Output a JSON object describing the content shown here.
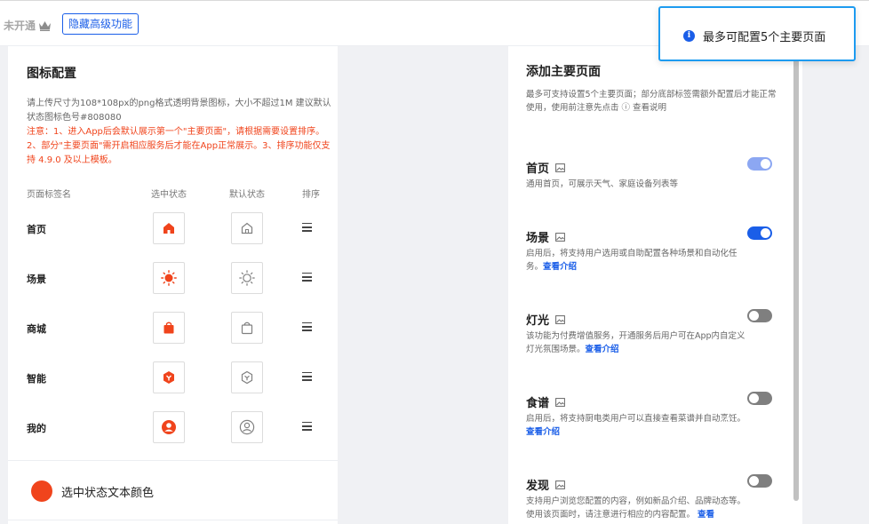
{
  "topbar": {
    "plan_label": "未开通",
    "hide_button": "隐藏高级功能"
  },
  "icon_config": {
    "title": "图标配置",
    "description": "请上传尺寸为108*108px的png格式透明背景图标，大小不超过1M 建议默认状态图标色号#808080",
    "notice": "注意：1、进入App后会默认展示第一个\"主要页面\"，请根据需要设置排序。2、部分\"主要页面\"需开启相应服务后才能在App正常展示。3、排序功能仅支持 4.9.0 及以上模板。",
    "columns": [
      "页面标签名",
      "选中状态",
      "默认状态",
      "排序"
    ],
    "rows": [
      {
        "label": "首页",
        "icon": "home-icon"
      },
      {
        "label": "场景",
        "icon": "sun-icon"
      },
      {
        "label": "商城",
        "icon": "shopping-bag-icon"
      },
      {
        "label": "智能",
        "icon": "hexagon-icon"
      },
      {
        "label": "我的",
        "icon": "user-icon"
      }
    ],
    "selected_color_label": "选中状态文本颜色",
    "selected_color": "#f0441c",
    "default_icon_color": "#808080"
  },
  "main_pages": {
    "title": "添加主要页面",
    "description": "最多可支持设置5个主要页面；部分底部标签需额外配置后才能正常使用，使用前注意先点击 ⓘ 查看说明",
    "items": [
      {
        "name": "首页",
        "desc": "通用首页，可展示天气、家庭设备列表等",
        "link": "",
        "state": "on-disabled"
      },
      {
        "name": "场景",
        "desc": "启用后，将支持用户选用或自助配置各种场景和自动化任务。",
        "link": "查看介绍",
        "state": "on"
      },
      {
        "name": "灯光",
        "desc": "该功能为付费增值服务，开通服务后用户可在App内自定义灯光氛围场景。",
        "link": "查看介绍",
        "state": "off"
      },
      {
        "name": "食谱",
        "desc": "启用后，将支持厨电类用户可以直接查看菜谱并自动烹饪。",
        "link": "查看介绍",
        "state": "off"
      },
      {
        "name": "发现",
        "desc": "支持用户浏览您配置的内容，例如新品介绍、品牌动态等。使用该页面时，请注意进行相应的内容配置。",
        "link": "查看",
        "state": "off"
      }
    ]
  },
  "toast": {
    "message": "最多可配置5个主要页面",
    "icon": "info-icon"
  },
  "colors": {
    "accent": "#1a5ee8",
    "warning": "#f0441c",
    "toast_border": "#1d9bf0"
  }
}
